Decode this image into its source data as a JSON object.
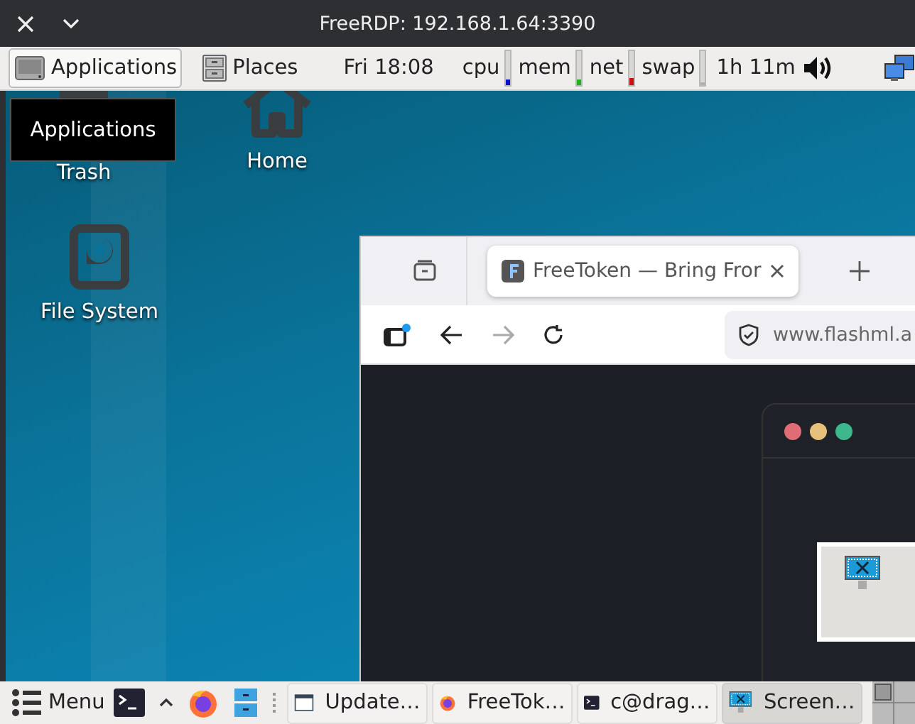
{
  "window": {
    "title": "FreeRDP: 192.168.1.64:3390"
  },
  "panel": {
    "items": [
      {
        "kind": "menu",
        "label": "Applications",
        "selected": true
      },
      {
        "kind": "menu",
        "label": "Places",
        "selected": false
      },
      {
        "kind": "clock",
        "label": "Fri 18:08"
      },
      {
        "kind": "meter",
        "label": "cpu",
        "color": "#1010c8",
        "level": 0.15
      },
      {
        "kind": "meter",
        "label": "mem",
        "color": "#20b020",
        "level": 0.15
      },
      {
        "kind": "meter",
        "label": "net",
        "color": "#c81010",
        "level": 0.2
      },
      {
        "kind": "meter",
        "label": "swap",
        "color": "#b0b0b0",
        "level": 0.1
      },
      {
        "kind": "battery",
        "label": "1h 11m"
      }
    ]
  },
  "tooltip": {
    "text": "Applications"
  },
  "desktop_icons": [
    {
      "kind": "trash",
      "label": "Trash"
    },
    {
      "kind": "home",
      "label": "Home"
    },
    {
      "kind": "drive",
      "label": "File System"
    }
  ],
  "browser": {
    "tabs": [
      {
        "title": "FreeToken — Bring Fror",
        "selected": true
      }
    ],
    "url": "www.flashml.a",
    "inner_window": {
      "dots": [
        {
          "color": "#e06c75"
        },
        {
          "color": "#e5c07b"
        },
        {
          "color": "#3cb88c"
        }
      ]
    }
  },
  "taskbar": {
    "menu_label": "Menu",
    "tasks": [
      {
        "kind": "window",
        "label": "Update…",
        "selected": false
      },
      {
        "kind": "firefox",
        "label": "FreeTok…",
        "selected": false
      },
      {
        "kind": "terminal",
        "label": "c@drag…",
        "selected": false
      },
      {
        "kind": "screenshot",
        "label": "Screen…",
        "selected": true
      }
    ]
  }
}
